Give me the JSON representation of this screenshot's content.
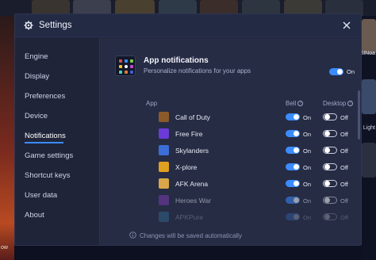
{
  "window": {
    "title": "Settings",
    "close_icon": "close-icon",
    "settings_icon": "gear-icon"
  },
  "background": {
    "right_labels": [
      "SINoa",
      "Light"
    ],
    "left_label": "ow"
  },
  "sidebar": {
    "items": [
      {
        "label": "Engine",
        "active": false
      },
      {
        "label": "Display",
        "active": false
      },
      {
        "label": "Preferences",
        "active": false
      },
      {
        "label": "Device",
        "active": false
      },
      {
        "label": "Notifications",
        "active": true
      },
      {
        "label": "Game settings",
        "active": false
      },
      {
        "label": "Shortcut keys",
        "active": false
      },
      {
        "label": "User data",
        "active": false
      },
      {
        "label": "About",
        "active": false
      }
    ]
  },
  "panel": {
    "title": "App notifications",
    "subtitle": "Personalize notifications for your apps",
    "master_toggle": {
      "state": "On",
      "enabled": true
    },
    "columns": {
      "app": "App",
      "bell": "Bell",
      "desktop": "Desktop"
    },
    "rows": [
      {
        "name": "Call of Duty",
        "bell": "On",
        "desktop": "Off",
        "icon_color": "#8b5a2b"
      },
      {
        "name": "Free Fire",
        "bell": "On",
        "desktop": "Off",
        "icon_color": "#6a3bd6"
      },
      {
        "name": "Skylanders",
        "bell": "On",
        "desktop": "Off",
        "icon_color": "#3b6ed6"
      },
      {
        "name": "X-plore",
        "bell": "On",
        "desktop": "Off",
        "icon_color": "#e0a020"
      },
      {
        "name": "AFK Arena",
        "bell": "On",
        "desktop": "Off",
        "icon_color": "#d9a64a"
      },
      {
        "name": "Heroes War",
        "bell": "On",
        "desktop": "Off",
        "icon_color": "#7a3ab0"
      },
      {
        "name": "APKPure",
        "bell": "On",
        "desktop": "Off",
        "icon_color": "#3aa0d6"
      }
    ],
    "footer": "Changes will be saved automatically"
  },
  "colors": {
    "accent": "#3a8cff",
    "dialog_bg": "#1f2439",
    "content_bg": "#262c44"
  }
}
